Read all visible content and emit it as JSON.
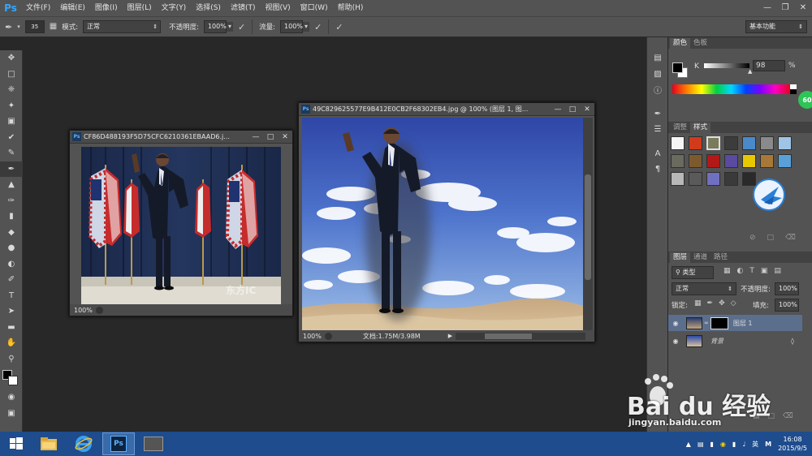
{
  "app": {
    "logo": "Ps"
  },
  "menu": [
    "文件(F)",
    "编辑(E)",
    "图像(I)",
    "图层(L)",
    "文字(Y)",
    "选择(S)",
    "滤镜(T)",
    "视图(V)",
    "窗口(W)",
    "帮助(H)"
  ],
  "options": {
    "brush_size": "35",
    "mode_label": "模式:",
    "mode_value": "正常",
    "opacity_label": "不透明度:",
    "opacity_value": "100%",
    "flow_label": "流量:",
    "flow_value": "100%",
    "workspace": "基本功能"
  },
  "doc1": {
    "title": "CF86D488193F5D75CFC6210361EBAAD6.j...",
    "zoom": "100%"
  },
  "doc2": {
    "title": "49C829625577E9B412E0CB2F68302EB4.jpg @ 100% (图层 1, 图...",
    "zoom": "100%",
    "doc_info": "文档:1.75M/3.98M"
  },
  "color_panel": {
    "tabs": [
      "颜色",
      "色板"
    ],
    "channel_label": "K",
    "k_value": "98",
    "unit": "%",
    "fg_color": "#000000",
    "bg_color": "#ffffff"
  },
  "badge": "60",
  "styles_panel": {
    "tabs": [
      "调整",
      "样式"
    ],
    "swatches": [
      "#f5f5f5",
      "#d23a1c",
      "#7a7a5c",
      "#3c3c3c",
      "#4a8acb",
      "#8a8a8a",
      "#a0c4e6",
      "#6a6a5e",
      "#7c5a2e",
      "#b21818",
      "#5a4aa0",
      "#e8c800",
      "#a87838",
      "#5aa0d8",
      "#b8b8b8",
      "#5a5a5a",
      "#7070c0",
      "#3a3a3a",
      "#2a2a2a"
    ]
  },
  "layers_panel": {
    "tabs": [
      "图层",
      "通道",
      "路径"
    ],
    "kind_label": "类型",
    "blend_mode": "正常",
    "opacity_label": "不透明度:",
    "opacity_value": "100%",
    "lock_label": "锁定:",
    "fill_label": "填充:",
    "fill_value": "100%",
    "layers": [
      {
        "name": "图层 1",
        "selected": true
      },
      {
        "name": "背景",
        "selected": false
      }
    ]
  },
  "watermark": {
    "brand": "Bai du 经验",
    "url": "jingyan.baidu.com",
    "photo_mark": "东方IC"
  },
  "taskbar": {
    "ime": "英",
    "ime2": "M",
    "time": "16:08",
    "date": "2015/9/5"
  }
}
